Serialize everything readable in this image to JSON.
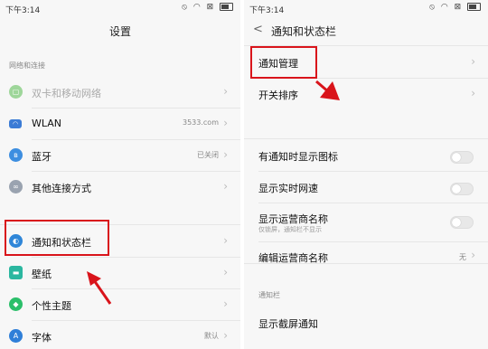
{
  "left": {
    "status_time": "下午3:14",
    "title": "设置",
    "section_network": "网络和连接",
    "items": [
      {
        "label": "双卡和移动网络",
        "value": ""
      },
      {
        "label": "WLAN",
        "value": "3533.com"
      },
      {
        "label": "蓝牙",
        "value": "已关闭"
      },
      {
        "label": "其他连接方式",
        "value": ""
      },
      {
        "label": "通知和状态栏",
        "value": ""
      },
      {
        "label": "壁纸",
        "value": ""
      },
      {
        "label": "个性主题",
        "value": ""
      },
      {
        "label": "字体",
        "value": "默认"
      }
    ]
  },
  "right": {
    "status_time": "下午3:14",
    "back_glyph": "<",
    "title": "通知和状态栏",
    "items": [
      {
        "label": "通知管理"
      },
      {
        "label": "开关排序"
      }
    ],
    "toggles": [
      {
        "label": "有通知时显示图标",
        "on": false
      },
      {
        "label": "显示实时网速",
        "on": false
      },
      {
        "label": "显示运营商名称",
        "sub": "仅锁屏，通知栏不显示",
        "on": false
      }
    ],
    "edit_carrier": {
      "label": "编辑运营商名称",
      "value": "无"
    },
    "section_notif": "通知栏",
    "lock_notif": {
      "label": "显示截屏通知"
    }
  },
  "colors": {
    "highlight": "#d9141b",
    "background": "#f7f7f7"
  }
}
